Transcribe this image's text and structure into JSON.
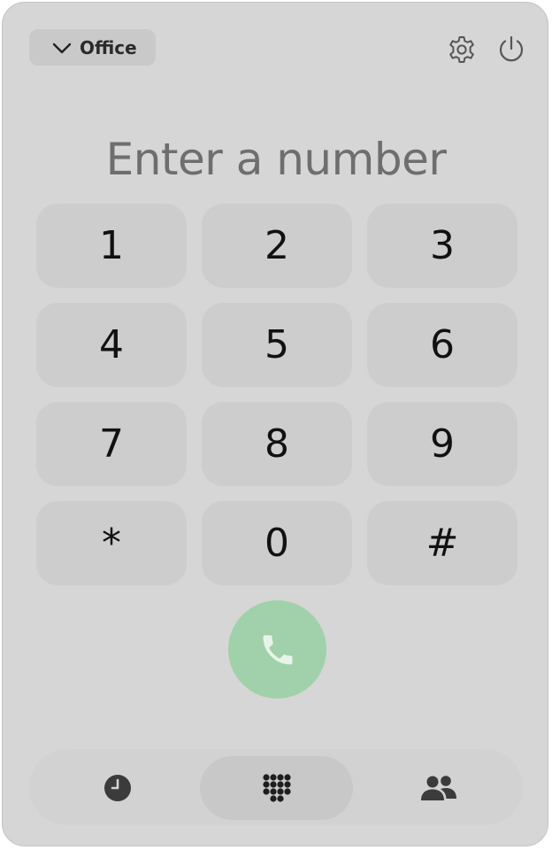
{
  "header": {
    "account_label": "Office",
    "icons": {
      "dropdown": "chevron-down-icon",
      "settings": "gear-icon",
      "power": "power-icon"
    }
  },
  "dial": {
    "placeholder": "Enter a number"
  },
  "keypad": {
    "keys": [
      "1",
      "2",
      "3",
      "4",
      "5",
      "6",
      "7",
      "8",
      "9",
      "*",
      "0",
      "#"
    ]
  },
  "call": {
    "icon": "phone-icon",
    "color": "#a0d1aa"
  },
  "bottom_nav": {
    "items": [
      {
        "icon": "clock-icon",
        "active": false
      },
      {
        "icon": "keypad-grid-icon",
        "active": true
      },
      {
        "icon": "contacts-icon",
        "active": false
      }
    ]
  }
}
